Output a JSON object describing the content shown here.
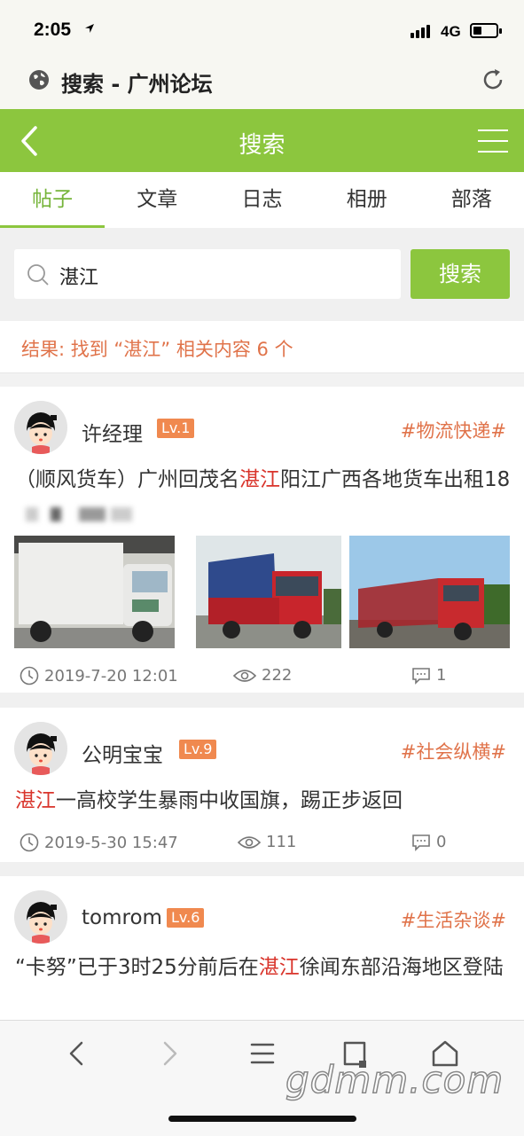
{
  "status": {
    "time": "2:05",
    "network": "4G"
  },
  "browser": {
    "page_title": "搜索 - 广州论坛"
  },
  "nav": {
    "title": "搜索"
  },
  "tabs": [
    {
      "label": "帖子",
      "active": true
    },
    {
      "label": "文章",
      "active": false
    },
    {
      "label": "日志",
      "active": false
    },
    {
      "label": "相册",
      "active": false
    },
    {
      "label": "部落",
      "active": false
    }
  ],
  "search": {
    "value": "湛江",
    "button_label": "搜索"
  },
  "result_text": "结果: 找到 “湛江” 相关内容 6 个",
  "posts": [
    {
      "user": "许经理",
      "level": "Lv.1",
      "tag": "#物流快递#",
      "title_pre": "（顺风货车）广州回茂名",
      "title_hl": "湛江",
      "title_post": "阳江广西各地货车出租18",
      "date": "2019-7-20 12:01",
      "views": "222",
      "comments": "1"
    },
    {
      "user": "公明宝宝",
      "level": "Lv.9",
      "tag": "#社会纵横#",
      "title_pre": "",
      "title_hl": "湛江",
      "title_post": "一高校学生暴雨中收国旗，踢正步返回",
      "date": "2019-5-30 15:47",
      "views": "111",
      "comments": "0"
    },
    {
      "user": "tomrom",
      "level": "Lv.6",
      "tag": "#生活杂谈#",
      "title_pre": "“卡努”已于3时25分前后在",
      "title_hl": "湛江",
      "title_post": "徐闻东部沿海地区登陆"
    }
  ],
  "watermark": "gdmm.com",
  "colors": {
    "accent": "#8cc63e",
    "tag": "#e0734a",
    "highlight": "#d9342b",
    "level_badge": "#f0894f"
  }
}
